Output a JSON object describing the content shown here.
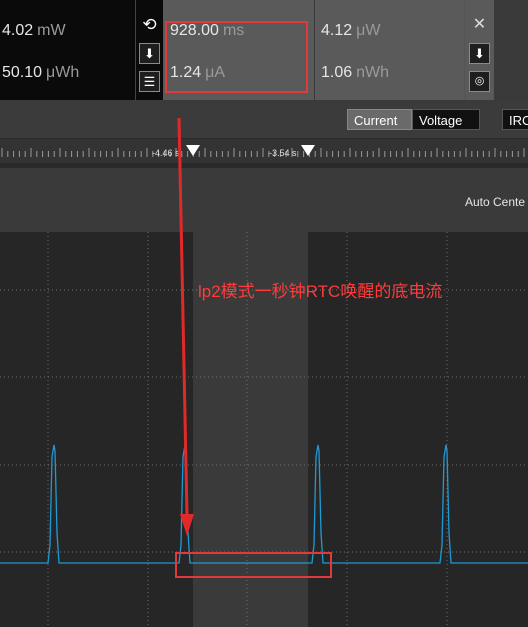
{
  "stats": {
    "power": {
      "value": "4.02",
      "unit": "mW"
    },
    "energy": {
      "value": "50.10",
      "unit": "μWh"
    },
    "selection_duration": {
      "value": "928.00",
      "unit": "ms"
    },
    "selection_current": {
      "value": "1.24",
      "unit": "μA"
    },
    "selection_power": {
      "value": "4.12",
      "unit": "μW"
    },
    "selection_energy": {
      "value": "1.06",
      "unit": "nWh"
    }
  },
  "toolbar": {
    "icons": [
      "reset-icon",
      "download-icon",
      "list-icon",
      "close-icon",
      "download-icon",
      "screenshot-icon"
    ]
  },
  "toggle": {
    "current": "Current",
    "voltage": "Voltage",
    "range_label": "IRC",
    "active": "Current"
  },
  "ruler": {
    "markers": [
      {
        "label": "-4.46 s"
      },
      {
        "label": "-3.54 s"
      }
    ]
  },
  "view": {
    "auto_center": "Auto Cente"
  },
  "annotation": {
    "text": "lp2模式一秒钟RTC唤醒的底电流"
  },
  "colors": {
    "trace": "#1e9ad6",
    "annotation": "#ff2a2a",
    "selection_band": "#3a3a3a"
  },
  "chart_data": {
    "type": "line",
    "series": [
      {
        "values": [
          0,
          1,
          0,
          1,
          0,
          1,
          0
        ]
      }
    ],
    "spikes": 4
  }
}
